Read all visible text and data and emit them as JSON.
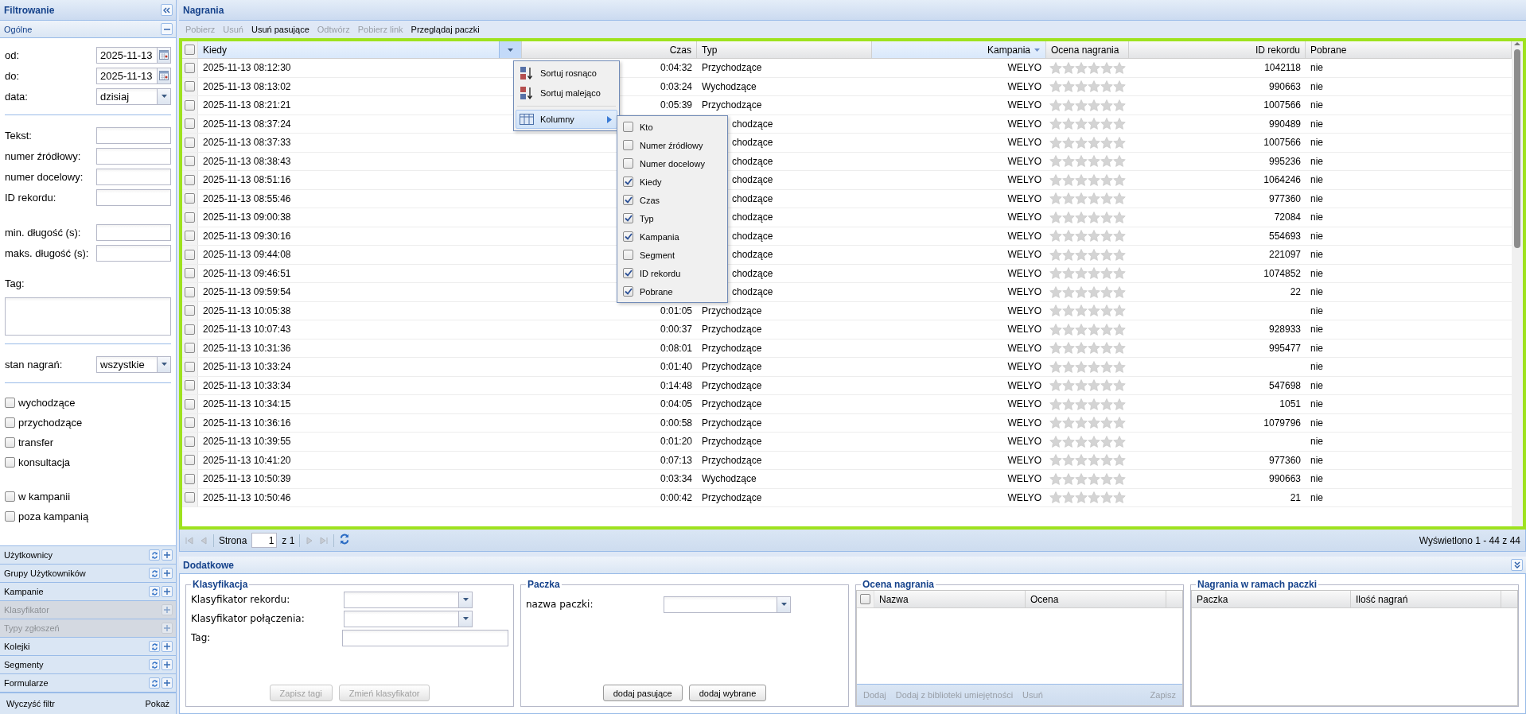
{
  "filter_panel": {
    "title": "Filtrowanie",
    "section": {
      "title": "Ogólne",
      "expanded": true
    },
    "groups": [
      {
        "blocks": [
          [
            {
              "kind": "date",
              "label": "od:",
              "value": "2025-11-13"
            },
            {
              "kind": "date",
              "label": "do:",
              "value": "2025-11-13"
            },
            {
              "kind": "select",
              "label": "data:",
              "value": "dzisiaj"
            }
          ]
        ]
      },
      {
        "blocks": [
          [
            {
              "kind": "text",
              "label": "Tekst:"
            },
            {
              "kind": "text",
              "label": "numer źródłowy:"
            },
            {
              "kind": "text",
              "label": "numer docelowy:"
            },
            {
              "kind": "text",
              "label": "ID rekordu:"
            }
          ],
          [
            {
              "kind": "text",
              "label": "min. długość (s):"
            },
            {
              "kind": "text",
              "label": "maks. długość (s):"
            }
          ],
          [
            {
              "kind": "textarea",
              "label": "Tag:"
            }
          ]
        ]
      },
      {
        "blocks": [
          [
            {
              "kind": "select",
              "label": "stan nagrań:",
              "value": "wszystkie"
            }
          ]
        ]
      },
      {
        "blocks": [
          [
            {
              "kind": "checkbox",
              "label": "wychodzące",
              "checked": false
            },
            {
              "kind": "checkbox",
              "label": "przychodzące",
              "checked": false
            },
            {
              "kind": "checkbox",
              "label": "transfer",
              "checked": false
            },
            {
              "kind": "checkbox",
              "label": "konsultacja",
              "checked": false
            }
          ],
          [
            {
              "kind": "checkbox",
              "label": "w kampanii",
              "checked": false
            },
            {
              "kind": "checkbox",
              "label": "poza kampanią",
              "checked": false
            }
          ]
        ]
      }
    ],
    "accordion": [
      {
        "label": "Użytkownicy",
        "disabled": false
      },
      {
        "label": "Grupy Użytkowników",
        "disabled": false
      },
      {
        "label": "Kampanie",
        "disabled": false
      },
      {
        "label": "Klasyfikator",
        "disabled": true
      },
      {
        "label": "Typy zgłoszeń",
        "disabled": true
      },
      {
        "label": "Kolejki",
        "disabled": false
      },
      {
        "label": "Segmenty",
        "disabled": false
      },
      {
        "label": "Formularze",
        "disabled": false
      }
    ],
    "footer": [
      "Wyczyść filtr",
      "Pokaż"
    ]
  },
  "recordings": {
    "title": "Nagrania",
    "toolbar": [
      {
        "label": "Pobierz",
        "disabled": true
      },
      {
        "label": "Usuń",
        "disabled": true
      },
      {
        "label": "Usuń pasujące",
        "disabled": false
      },
      {
        "label": "Odtwórz",
        "disabled": true
      },
      {
        "label": "Pobierz link",
        "disabled": true
      },
      {
        "label": "Przeglądaj paczki",
        "disabled": false
      }
    ],
    "grid": {
      "select_all_checked": false,
      "columns": [
        {
          "label": "Kiedy",
          "kind": "left",
          "sorted": false,
          "menu_open": true
        },
        {
          "label": "Czas",
          "kind": "right",
          "sorted": false,
          "menu_open": false
        },
        {
          "label": "Typ",
          "kind": "left",
          "sorted": false,
          "menu_open": false
        },
        {
          "label": "Kampania",
          "kind": "right",
          "sorted": true,
          "menu_open": false
        },
        {
          "label": "Ocena nagrania",
          "kind": "stars",
          "sorted": false,
          "menu_open": false
        },
        {
          "label": "ID rekordu",
          "kind": "right",
          "sorted": false,
          "menu_open": false
        },
        {
          "label": "Pobrane",
          "kind": "left",
          "sorted": false,
          "menu_open": false
        }
      ],
      "rows": [
        {
          "checked": false,
          "stars": 0,
          "cells": [
            "2025-11-13 08:12:30",
            "0:04:32",
            "Przychodzące",
            "WELYO",
            null,
            "1042118",
            "nie"
          ]
        },
        {
          "checked": false,
          "stars": 0,
          "cells": [
            "2025-11-13 08:13:02",
            "0:03:24",
            "Wychodzące",
            "WELYO",
            null,
            "990663",
            "nie"
          ]
        },
        {
          "checked": false,
          "stars": 0,
          "cells": [
            "2025-11-13 08:21:21",
            "0:05:39",
            "Przychodzące",
            "WELYO",
            null,
            "1007566",
            "nie"
          ]
        },
        {
          "checked": false,
          "stars": 0,
          "cells": [
            "2025-11-13 08:37:24",
            null,
            "chodzące",
            "WELYO",
            null,
            "990489",
            "nie"
          ]
        },
        {
          "checked": false,
          "stars": 0,
          "cells": [
            "2025-11-13 08:37:33",
            null,
            "chodzące",
            "WELYO",
            null,
            "1007566",
            "nie"
          ]
        },
        {
          "checked": false,
          "stars": 0,
          "cells": [
            "2025-11-13 08:38:43",
            null,
            "chodzące",
            "WELYO",
            null,
            "995236",
            "nie"
          ]
        },
        {
          "checked": false,
          "stars": 0,
          "cells": [
            "2025-11-13 08:51:16",
            null,
            "chodzące",
            "WELYO",
            null,
            "1064246",
            "nie"
          ]
        },
        {
          "checked": false,
          "stars": 0,
          "cells": [
            "2025-11-13 08:55:46",
            null,
            "chodzące",
            "WELYO",
            null,
            "977360",
            "nie"
          ]
        },
        {
          "checked": false,
          "stars": 0,
          "cells": [
            "2025-11-13 09:00:38",
            null,
            "chodzące",
            "WELYO",
            null,
            "72084",
            "nie"
          ]
        },
        {
          "checked": false,
          "stars": 0,
          "cells": [
            "2025-11-13 09:30:16",
            null,
            "chodzące",
            "WELYO",
            null,
            "554693",
            "nie"
          ]
        },
        {
          "checked": false,
          "stars": 0,
          "cells": [
            "2025-11-13 09:44:08",
            null,
            "chodzące",
            "WELYO",
            null,
            "221097",
            "nie"
          ]
        },
        {
          "checked": false,
          "stars": 0,
          "cells": [
            "2025-11-13 09:46:51",
            null,
            "chodzące",
            "WELYO",
            null,
            "1074852",
            "nie"
          ]
        },
        {
          "checked": false,
          "stars": 0,
          "cells": [
            "2025-11-13 09:59:54",
            null,
            "chodzące",
            "WELYO",
            null,
            "22",
            "nie"
          ]
        },
        {
          "checked": false,
          "stars": 0,
          "cells": [
            "2025-11-13 10:05:38",
            "0:01:05",
            "Przychodzące",
            "WELYO",
            null,
            null,
            "nie"
          ]
        },
        {
          "checked": false,
          "stars": 0,
          "cells": [
            "2025-11-13 10:07:43",
            "0:00:37",
            "Przychodzące",
            "WELYO",
            null,
            "928933",
            "nie"
          ]
        },
        {
          "checked": false,
          "stars": 0,
          "cells": [
            "2025-11-13 10:31:36",
            "0:08:01",
            "Przychodzące",
            "WELYO",
            null,
            "995477",
            "nie"
          ]
        },
        {
          "checked": false,
          "stars": 0,
          "cells": [
            "2025-11-13 10:33:24",
            "0:01:40",
            "Przychodzące",
            "WELYO",
            null,
            null,
            "nie"
          ]
        },
        {
          "checked": false,
          "stars": 0,
          "cells": [
            "2025-11-13 10:33:34",
            "0:14:48",
            "Przychodzące",
            "WELYO",
            null,
            "547698",
            "nie"
          ]
        },
        {
          "checked": false,
          "stars": 0,
          "cells": [
            "2025-11-13 10:34:15",
            "0:04:05",
            "Przychodzące",
            "WELYO",
            null,
            "1051",
            "nie"
          ]
        },
        {
          "checked": false,
          "stars": 0,
          "cells": [
            "2025-11-13 10:36:16",
            "0:00:58",
            "Przychodzące",
            "WELYO",
            null,
            "1079796",
            "nie"
          ]
        },
        {
          "checked": false,
          "stars": 0,
          "cells": [
            "2025-11-13 10:39:55",
            "0:01:20",
            "Przychodzące",
            "WELYO",
            null,
            null,
            "nie"
          ]
        },
        {
          "checked": false,
          "stars": 0,
          "cells": [
            "2025-11-13 10:41:20",
            "0:07:13",
            "Przychodzące",
            "WELYO",
            null,
            "977360",
            "nie"
          ]
        },
        {
          "checked": false,
          "stars": 0,
          "cells": [
            "2025-11-13 10:50:39",
            "0:03:34",
            "Wychodzące",
            "WELYO",
            null,
            "990663",
            "nie"
          ]
        },
        {
          "checked": false,
          "stars": 0,
          "cells": [
            "2025-11-13 10:50:46",
            "0:00:42",
            "Przychodzące",
            "WELYO",
            null,
            "21",
            "nie"
          ]
        }
      ]
    },
    "column_menu": {
      "items": [
        {
          "kind": "sort_asc",
          "label": "Sortuj rosnąco",
          "selected": false
        },
        {
          "kind": "sort_desc",
          "label": "Sortuj malejąco",
          "selected": false
        },
        {
          "kind": "columns",
          "label": "Kolumny",
          "selected": true
        }
      ],
      "columns": [
        {
          "label": "Kto",
          "checked": false
        },
        {
          "label": "Numer źródłowy",
          "checked": false
        },
        {
          "label": "Numer docelowy",
          "checked": false
        },
        {
          "label": "Kiedy",
          "checked": true
        },
        {
          "label": "Czas",
          "checked": true
        },
        {
          "label": "Typ",
          "checked": true
        },
        {
          "label": "Kampania",
          "checked": true
        },
        {
          "label": "Segment",
          "checked": false
        },
        {
          "label": "ID rekordu",
          "checked": true
        },
        {
          "label": "Pobrane",
          "checked": true
        }
      ]
    },
    "pager": {
      "page_label": "Strona",
      "page": "1",
      "of": "z 1",
      "summary": "Wyświetlono 1 - 44 z 44"
    }
  },
  "details": {
    "title": "Dodatkowe",
    "classification": {
      "title": "Klasyfikacja",
      "fields": [
        {
          "kind": "combo",
          "label": "Klasyfikator rekordu:"
        },
        {
          "kind": "combo",
          "label": "Klasyfikator połączenia:"
        },
        {
          "kind": "text",
          "label": "Tag:"
        }
      ],
      "buttons": [
        {
          "label": "Zapisz tagi",
          "disabled": true
        },
        {
          "label": "Zmień klasyfikator",
          "disabled": true
        }
      ]
    },
    "package": {
      "title": "Paczka",
      "fields": [
        {
          "kind": "combo",
          "label": "nazwa paczki:"
        }
      ],
      "buttons": [
        {
          "label": "dodaj pasujące",
          "disabled": false
        },
        {
          "label": "dodaj wybrane",
          "disabled": false
        }
      ]
    },
    "rating": {
      "title": "Ocena nagrania",
      "select_all_checked": false,
      "columns": [
        "Nazwa",
        "Ocena"
      ],
      "toolbar": {
        "left": [
          {
            "label": "Dodaj",
            "disabled": true
          },
          {
            "label": "Dodaj z biblioteki umiejętności",
            "disabled": true
          },
          {
            "label": "Usuń",
            "disabled": true
          }
        ],
        "right": [
          {
            "label": "Zapisz",
            "disabled": true
          }
        ]
      }
    },
    "packages": {
      "title": "Nagrania w ramach paczki",
      "columns": [
        "Paczka",
        "Ilość nagrań"
      ]
    }
  }
}
